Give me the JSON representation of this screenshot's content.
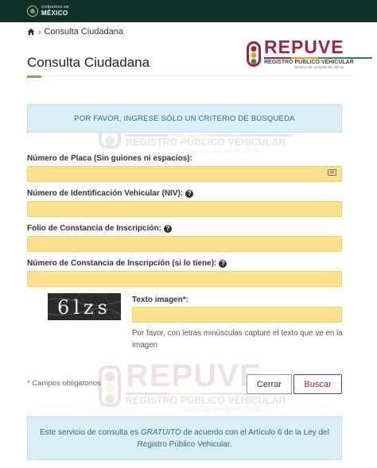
{
  "header": {
    "gov_line1": "GOBIERNO DE",
    "gov_line2": "MÉXICO",
    "background": "#10302c"
  },
  "breadcrumb": {
    "home_icon": "home-icon",
    "current": "Consulta Ciudadana"
  },
  "page": {
    "title": "Consulta Ciudadana",
    "accent": "#b38e5d"
  },
  "logo": {
    "name": "REPUVE",
    "subtitle": "REGISTRO PÚBLICO VEHICULAR",
    "tagline": "Servicio de consulta NO Oficial",
    "brand_color": "#9d2449",
    "band_colors": [
      "#9d2449",
      "#e0a41c",
      "#3f8f3a",
      "#2d6fb5"
    ]
  },
  "watermark": {
    "name": "REPUVE",
    "subtitle": "REGISTRO PÚBLICO VEHICULAR",
    "tagline": "Servicio de consulta NO Oficial"
  },
  "alert": {
    "text": "POR FAVOR, INGRESE SÓLO UN CRITERIO DE BÚSQUEDA"
  },
  "form": {
    "placa": {
      "label": "Número de Placa (Sin guiones ni espacios):",
      "value": "",
      "trailing_icon": "keyboard-icon"
    },
    "niv": {
      "label": "Número de Identificación Vehicular (NIV):",
      "value": "",
      "help_icon": "help-icon"
    },
    "folio": {
      "label": "Folio de Constancia de Inscripción:",
      "value": "",
      "help_icon": "help-icon"
    },
    "constancia": {
      "label": "Número de Constancia de Inscripción (si lo tiene):",
      "value": "",
      "help_icon": "help-icon"
    },
    "input_color": "#fbe18b"
  },
  "captcha": {
    "image_text": "6lzs",
    "label": "Texto imagen*:",
    "value": "",
    "hint": "Por favor, con letras minúsculas capture el texto que ve en la imagen"
  },
  "footer": {
    "required_note": "* Campos obligatorios",
    "cerrar_label": "Cerrar",
    "buscar_label": "Buscar"
  },
  "info": {
    "before": "Este servicio de consulta es ",
    "emphasis": "GRATUITO",
    "after": " de acuerdo con el Artículo 6 de la Ley del Registro Público Vehicular."
  }
}
